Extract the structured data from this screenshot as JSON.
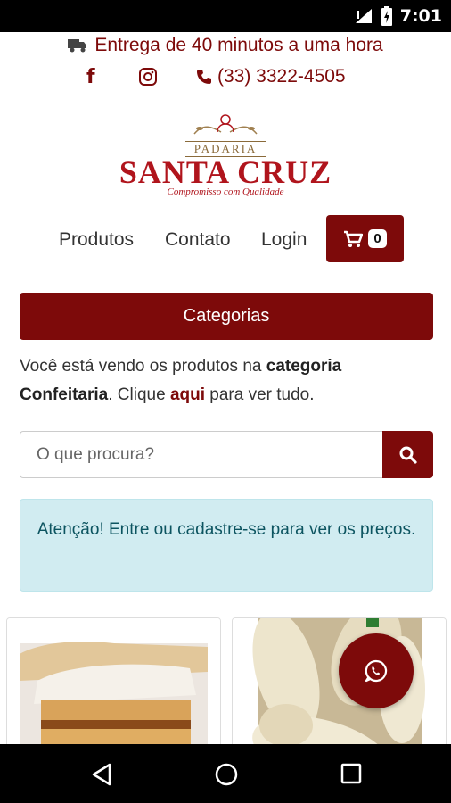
{
  "status_bar": {
    "time": "7:01"
  },
  "header": {
    "delivery_text": "Entrega de 40 minutos a uma hora",
    "facebook_glyph": "f",
    "phone": "(33) 3322-4505"
  },
  "logo": {
    "padaria": "PADARIA",
    "brand": "SANTA CRUZ",
    "tagline": "Compromisso com Qualidade"
  },
  "nav": {
    "produtos": "Produtos",
    "contato": "Contato",
    "login": "Login",
    "cart_count": "0"
  },
  "categorias_button": "Categorias",
  "info": {
    "part1": "Você está vendo os produtos na ",
    "bold1": "categoria Confeitaria",
    "part2": ". Clique ",
    "link": "aqui",
    "part3": " para ver tudo."
  },
  "search": {
    "placeholder": "O que procura?"
  },
  "alert": "Atenção! Entre ou cadastre-se para ver os preços.",
  "colors": {
    "brand": "#7d0a0a",
    "brand_bright": "#b0141c",
    "alert_bg": "#d1ecf1",
    "alert_text": "#0c5460"
  },
  "icons": [
    "truck-icon",
    "facebook-icon",
    "instagram-icon",
    "phone-icon",
    "cart-icon",
    "search-icon",
    "whatsapp-icon"
  ]
}
